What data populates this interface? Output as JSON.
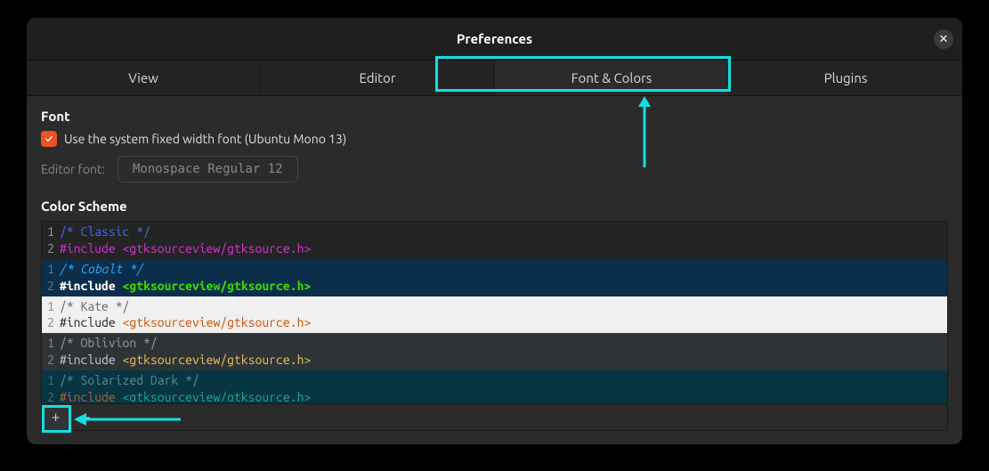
{
  "window": {
    "title": "Preferences"
  },
  "tabs": [
    "View",
    "Editor",
    "Font & Colors",
    "Plugins"
  ],
  "active_tab": "Font & Colors",
  "font_section": {
    "heading": "Font",
    "use_system_label": "Use the system fixed width font (Ubuntu Mono 13)",
    "use_system_checked": true,
    "editor_font_label": "Editor font:",
    "editor_font_value": "Monospace Regular  12"
  },
  "color_scheme": {
    "heading": "Color Scheme",
    "schemes": [
      {
        "name": "Classic",
        "line1_comment": "/* Classic */",
        "line2_kw": "#include",
        "line2_path": "<gtksourceview/gtksource.h>",
        "style": "classic"
      },
      {
        "name": "Cobalt",
        "line1_comment": "/* Cobalt */",
        "line2_kw": "#include",
        "line2_path": "<gtksourceview/gtksource.h>",
        "style": "cobalt"
      },
      {
        "name": "Kate",
        "line1_comment": "/* Kate */",
        "line2_kw": "#include",
        "line2_path": "<gtksourceview/gtksource.h>",
        "style": "kate"
      },
      {
        "name": "Oblivion",
        "line1_comment": "/* Oblivion */",
        "line2_kw": "#include",
        "line2_path": "<gtksourceview/gtksource.h>",
        "style": "oblivion"
      },
      {
        "name": "Solarized Dark",
        "line1_comment": "/* Solarized Dark */",
        "line2_kw": "#include",
        "line2_path": "<gtksourceview/gtksource.h>",
        "style": "soldark"
      }
    ]
  },
  "annotations": {
    "highlight_color": "#12e0e0"
  }
}
